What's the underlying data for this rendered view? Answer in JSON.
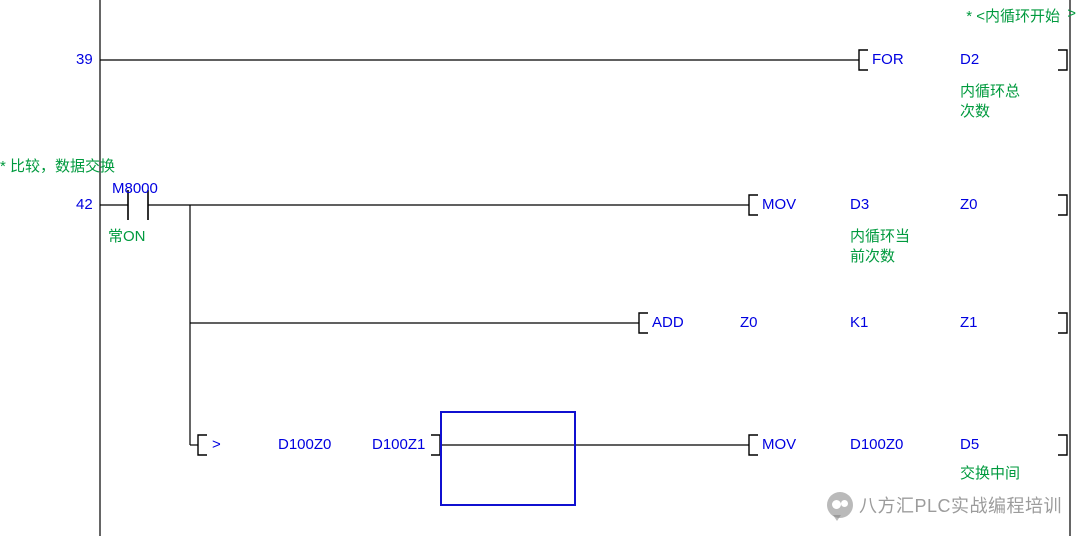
{
  "top_comment_left": "* <内循环开始",
  "top_comment_right": ">",
  "rungs": {
    "r1": {
      "addr": "39",
      "instr": "FOR",
      "op1": "D2",
      "op1_comment_l1": "内循环总",
      "op1_comment_l2": "次数"
    },
    "section_comment": "* 比较，数据交换",
    "r2": {
      "addr": "42",
      "contact": "M8000",
      "contact_comment": "常ON",
      "instr": "MOV",
      "op1": "D3",
      "op1_comment_l1": "内循环当",
      "op1_comment_l2": "前次数",
      "op2": "Z0"
    },
    "r3": {
      "instr": "ADD",
      "op1": "Z0",
      "op2": "K1",
      "op3": "Z1"
    },
    "r4": {
      "cmp_op": ">",
      "cmp_a": "D100Z0",
      "cmp_b": "D100Z1",
      "instr": "MOV",
      "op1": "D100Z0",
      "op2": "D5",
      "op2_comment_l1": "交换中间"
    }
  },
  "watermark": "八方汇PLC实战编程培训"
}
